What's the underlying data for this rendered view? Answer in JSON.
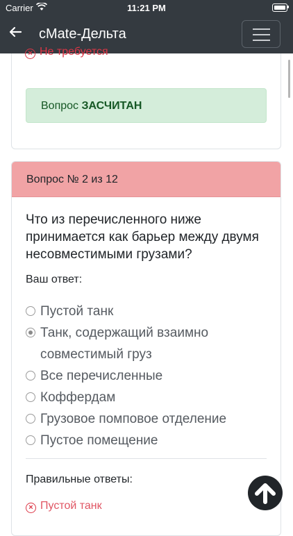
{
  "status_bar": {
    "carrier": "Carrier",
    "time": "11:21 PM"
  },
  "navbar": {
    "title": "cMate-Дельта"
  },
  "previous_question": {
    "partial_text": "Не требуется",
    "result_prefix": "Вопрос",
    "result_status": "ЗАСЧИТАН"
  },
  "current_question": {
    "header": "Вопрос № 2 из 12",
    "text": "Что из перечисленного ниже принимается как барьер между двумя несовместимыми грузами?",
    "your_answer_label": "Ваш ответ:",
    "options": [
      {
        "label": "Пустой танк",
        "selected": false
      },
      {
        "label": "Танк, содержащий взаимно совместимый груз",
        "selected": true
      },
      {
        "label": "Все перечисленные",
        "selected": false
      },
      {
        "label": "Коффердам",
        "selected": false
      },
      {
        "label": "Грузовое помповое отделение",
        "selected": false
      },
      {
        "label": "Пустое помещение",
        "selected": false
      }
    ],
    "correct_label": "Правильные ответы:",
    "correct_answer": "Пустой танк"
  },
  "colors": {
    "navbar_bg": "#343a40",
    "success_bg": "#d4edda",
    "success_text": "#155724",
    "wrong_header_bg": "#f1a3a5",
    "wrong_text": "#dc3545"
  }
}
